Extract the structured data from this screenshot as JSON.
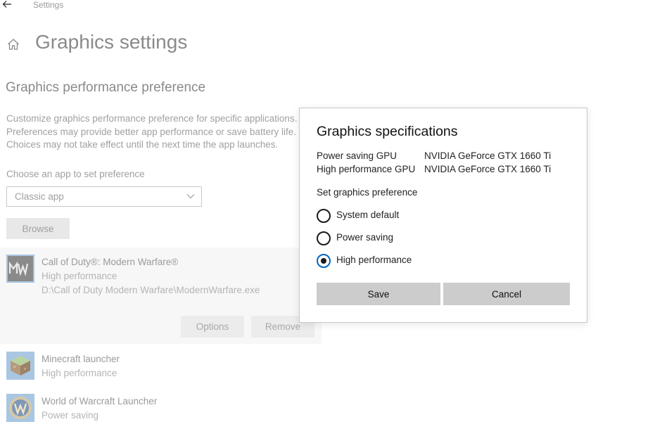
{
  "window": {
    "title": "Settings"
  },
  "page": {
    "title": "Graphics settings",
    "section_title": "Graphics performance preference",
    "description_lines": [
      "Customize graphics performance preference for specific applications.",
      "Preferences may provide better app performance or save battery life.",
      "Choices may not take effect until the next time the app launches."
    ],
    "choose_label": "Choose an app to set preference",
    "app_type_select": {
      "selected": "Classic app"
    },
    "browse_label": "Browse"
  },
  "apps": [
    {
      "name": "Call of Duty®: Modern Warfare®",
      "preference": "High performance",
      "path": "D:\\Call of Duty Modern Warfare\\ModernWarfare.exe",
      "icon": "modern-warfare-icon",
      "options_label": "Options",
      "remove_label": "Remove"
    },
    {
      "name": "Minecraft launcher",
      "preference": "High performance",
      "icon": "minecraft-icon"
    },
    {
      "name": "World of Warcraft Launcher",
      "preference": "Power saving",
      "icon": "warcraft-icon"
    }
  ],
  "dialog": {
    "title": "Graphics specifications",
    "specs": [
      {
        "label": "Power saving GPU",
        "value": "NVIDIA GeForce GTX 1660 Ti"
      },
      {
        "label": "High performance GPU",
        "value": "NVIDIA GeForce GTX 1660 Ti"
      }
    ],
    "preference_heading": "Set graphics preference",
    "options": [
      {
        "label": "System default",
        "checked": false
      },
      {
        "label": "Power saving",
        "checked": false
      },
      {
        "label": "High performance",
        "checked": true
      }
    ],
    "save_label": "Save",
    "cancel_label": "Cancel"
  },
  "colors": {
    "accent": "#0067c0",
    "button_gray": "#cccccc",
    "dim_text": "#a0a0a0"
  }
}
